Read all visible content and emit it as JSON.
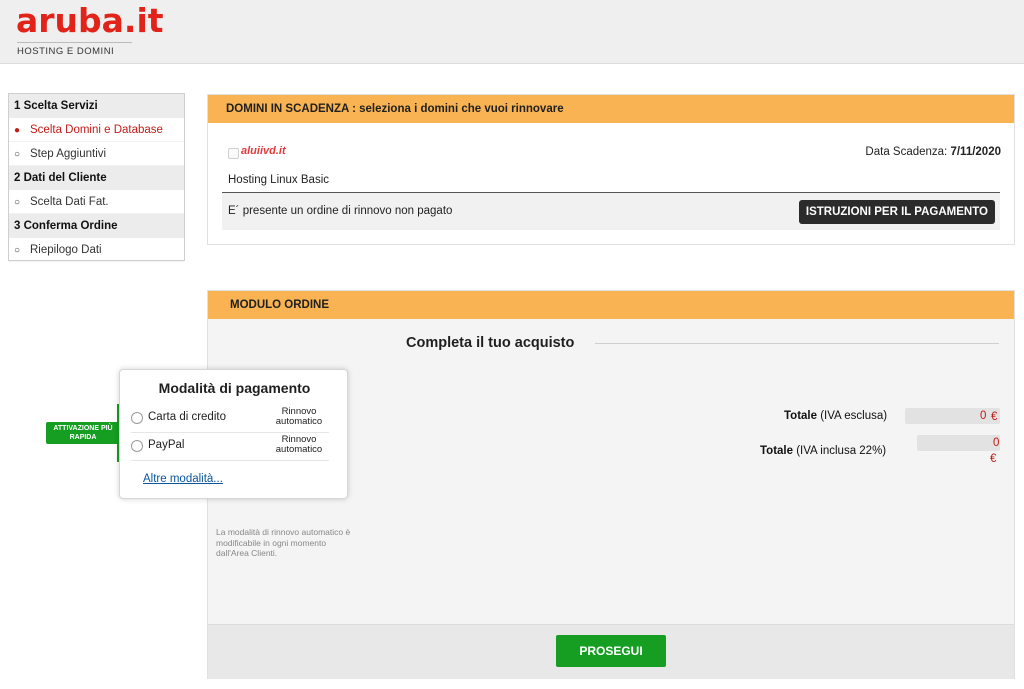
{
  "header": {
    "logo_text": "aruba.it",
    "logo_tagline": "HOSTING E DOMINI",
    "brand_color": "#e2231a"
  },
  "steps": [
    {
      "title": "1 Scelta Servizi",
      "items": [
        {
          "label": "Scelta Domini e Database",
          "active": true
        },
        {
          "label": "Step Aggiuntivi",
          "active": false
        }
      ]
    },
    {
      "title": "2 Dati del Cliente",
      "items": [
        {
          "label": "Scelta Dati Fat.",
          "active": false
        }
      ]
    },
    {
      "title": "3 Conferma Ordine",
      "items": [
        {
          "label": "Riepilogo Dati",
          "active": false
        }
      ]
    }
  ],
  "domains": {
    "title": "DOMINI IN SCADENZA : seleziona i domini che vuoi rinnovare",
    "domain_name": "aluiivd.it",
    "expiry_label": "Data Scadenza:",
    "expiry_date": "7/11/2020",
    "plan": "Hosting Linux Basic",
    "notice": "E´ presente un ordine di rinnovo non pagato",
    "payment_button": "ISTRUZIONI PER IL PAGAMENTO"
  },
  "order": {
    "title": "MODULO ORDINE",
    "subtitle": "Completa il tuo acquisto",
    "total_excl_bold": "Totale",
    "total_excl_rest": "(IVA esclusa)",
    "total_excl_value": "0",
    "total_incl_bold": "Totale",
    "total_incl_rest": "(IVA inclusa 22%)",
    "total_incl_value": "0",
    "currency": "€",
    "note": "La modalità di rinnovo automatico è modificabile in ogni momento dall'Area Clienti.",
    "continue_button": "PROSEGUI"
  },
  "payment": {
    "title": "Modalità di pagamento",
    "options": [
      {
        "label": "Carta di credito",
        "badge": "Rinnovo automatico"
      },
      {
        "label": "PayPal",
        "badge": "Rinnovo automatico"
      }
    ],
    "more_link": "Altre modalità...",
    "fast_tag": "ATTIVAZIONE PIÙ RAPIDA"
  }
}
